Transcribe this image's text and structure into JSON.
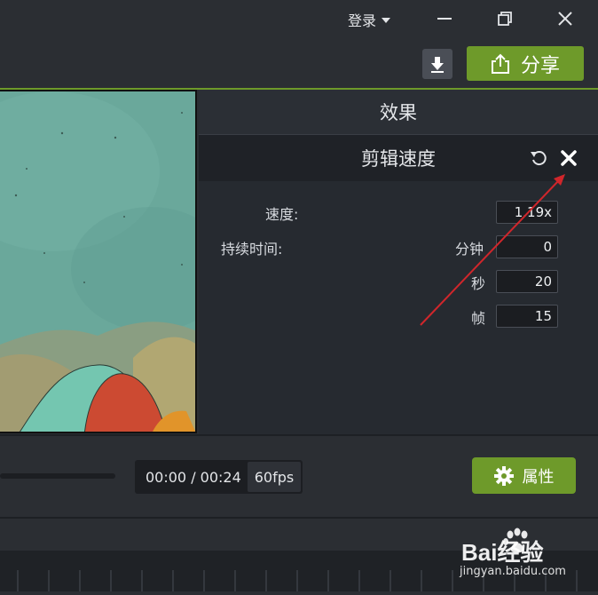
{
  "titlebar": {
    "login_label": "登录"
  },
  "toolbar": {
    "share_label": "分享"
  },
  "effects_panel": {
    "title": "效果",
    "effect_name": "剪辑速度",
    "speed": {
      "label": "速度:",
      "value": "1.19x"
    },
    "duration": {
      "label": "持续时间:",
      "minutes_label": "分钟",
      "minutes_value": "0",
      "seconds_label": "秒",
      "seconds_value": "20",
      "frames_label": "帧",
      "frames_value": "15"
    }
  },
  "playback": {
    "timecode": "00:00 / 00:24",
    "fps": "60fps"
  },
  "properties_button": {
    "label": "属性"
  },
  "watermark": {
    "brand": "Bai经验",
    "url": "jingyan.baidu.com"
  },
  "colors": {
    "accent": "#6e9a2a",
    "annotation_arrow": "#d0262b",
    "panel_bg": "#262a30"
  }
}
